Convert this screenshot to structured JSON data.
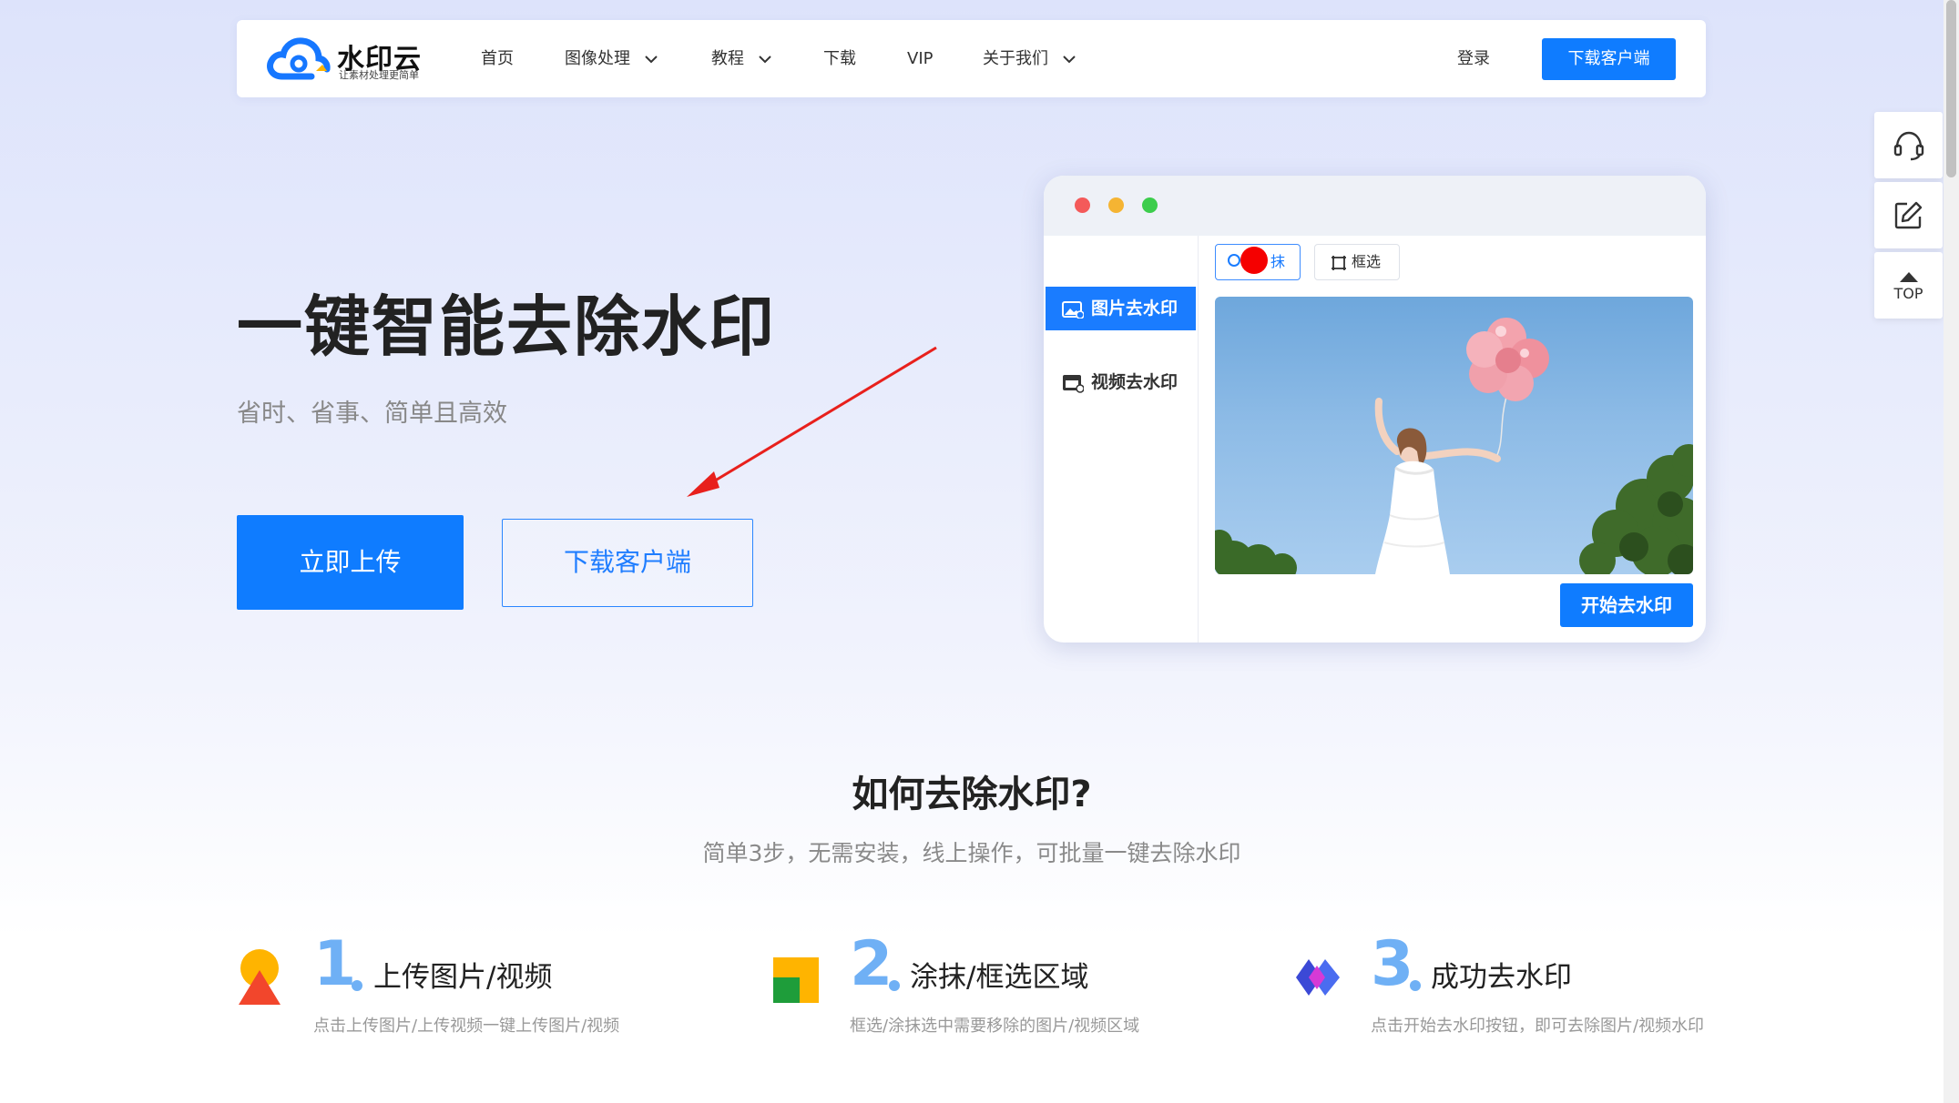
{
  "nav": {
    "logo_name": "水印云",
    "logo_slogan": "让素材处理更简单",
    "items": [
      "首页",
      "图像处理",
      "教程",
      "下载",
      "VIP",
      "关于我们"
    ],
    "login": "登录",
    "download_button": "下载客户端"
  },
  "hero": {
    "title": "一键智能去除水印",
    "subtitle": "省时、省事、简单且高效",
    "upload_button": "立即上传",
    "client_button": "下载客户端"
  },
  "mockup": {
    "side_items": [
      "图片去水印",
      "视频去水印"
    ],
    "tool_smear": "涂抹",
    "tool_smear_visible": "抹",
    "tool_box": "框选",
    "start_button": "开始去水印"
  },
  "float": {
    "top_label": "TOP"
  },
  "how": {
    "title": "如何去除水印?",
    "subtitle": "简单3步，无需安装，线上操作，可批量一键去除水印",
    "steps": [
      {
        "num": "1",
        "title": "上传图片/视频",
        "desc": "点击上传图片/上传视频一键上传图片/视频"
      },
      {
        "num": "2",
        "title": "涂抹/框选区域",
        "desc": "框选/涂抹选中需要移除的图片/视频区域"
      },
      {
        "num": "3",
        "title": "成功去水印",
        "desc": "点击开始去水印按钮，即可去除图片/视频水印"
      }
    ]
  },
  "colors": {
    "primary": "#0f7cff",
    "step_number": "#6fb0f5"
  }
}
